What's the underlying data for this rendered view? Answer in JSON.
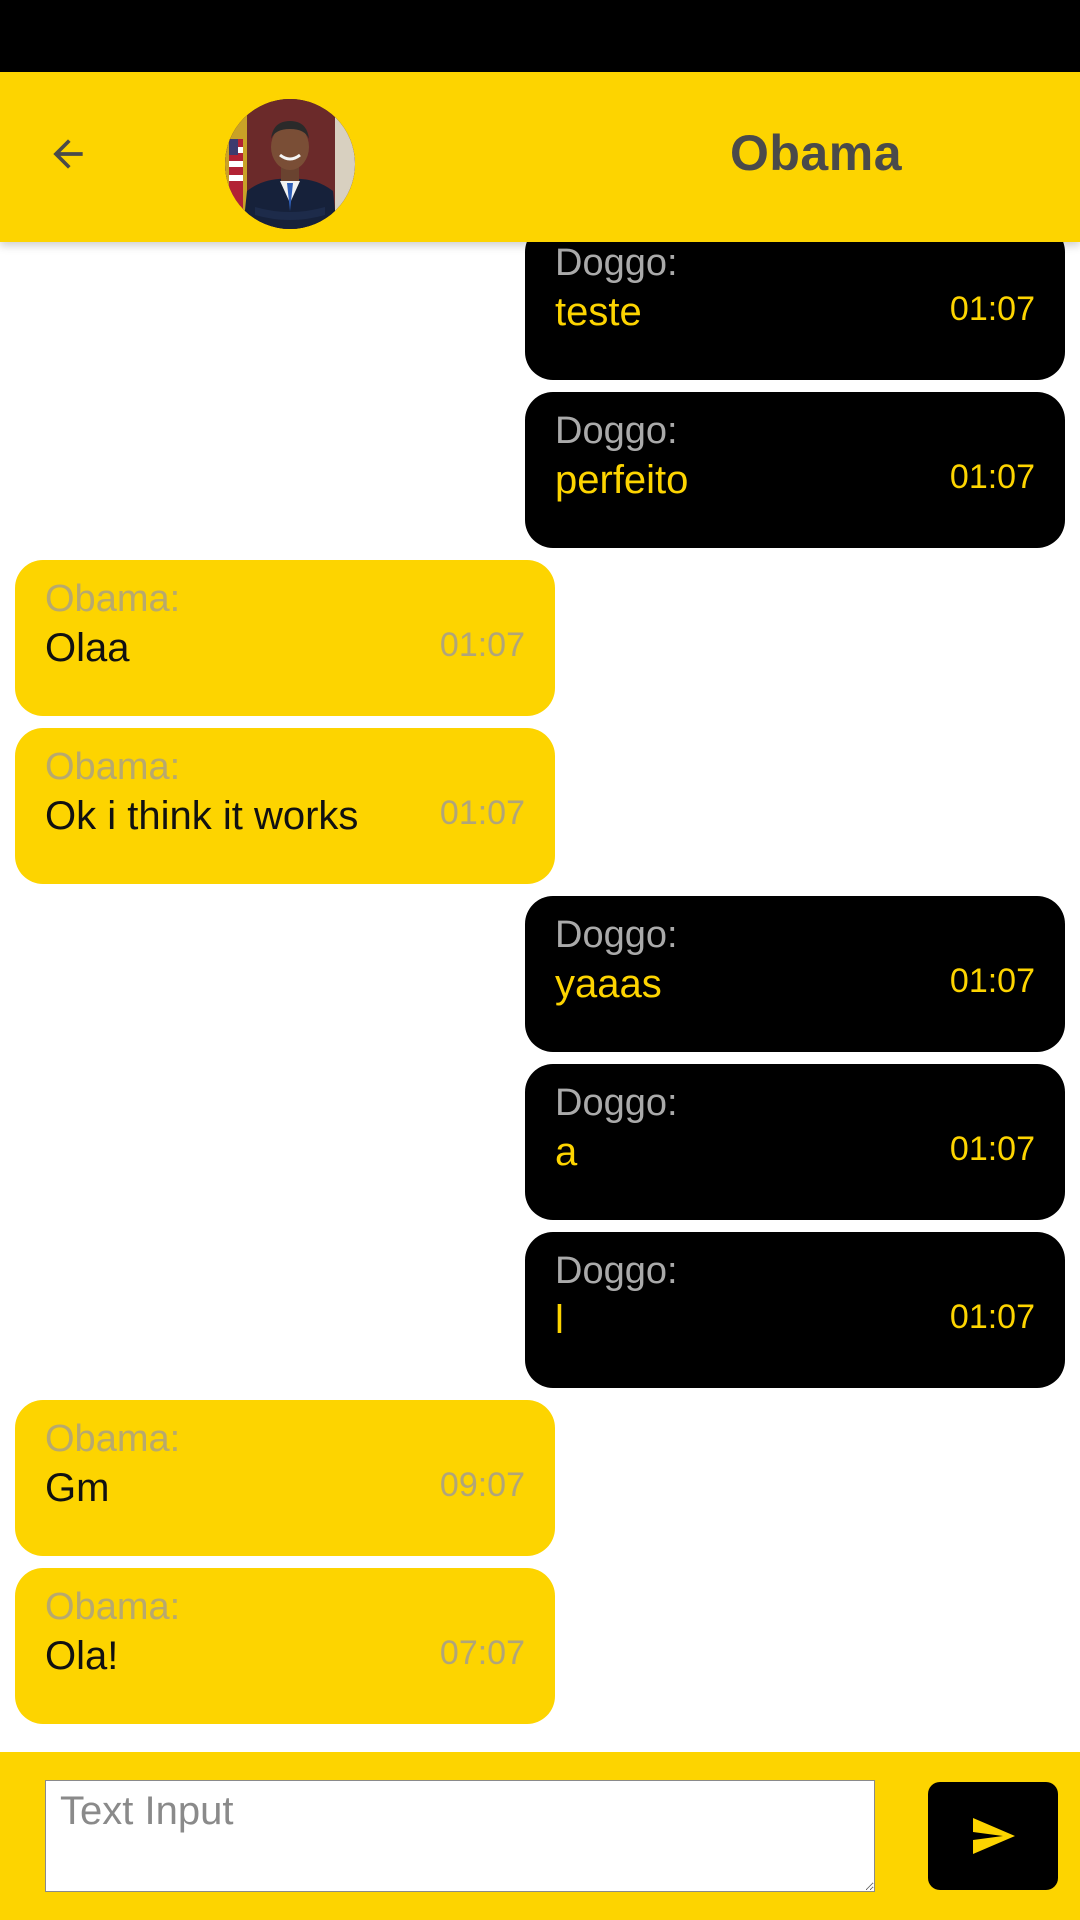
{
  "header": {
    "title": "Obama",
    "back_icon": "arrow-left-icon",
    "avatar_alt": "Obama avatar"
  },
  "colors": {
    "accent": "#FDD400",
    "sent_bubble": "#000000",
    "header_text": "#4A4A4A"
  },
  "messages": [
    {
      "side": "sent",
      "sender": "Doggo:",
      "text": "teste",
      "time": "01:07"
    },
    {
      "side": "sent",
      "sender": "Doggo:",
      "text": "perfeito",
      "time": "01:07"
    },
    {
      "side": "received",
      "sender": "Obama:",
      "text": "Olaa",
      "time": "01:07"
    },
    {
      "side": "received",
      "sender": "Obama:",
      "text": "Ok i think it works",
      "time": "01:07"
    },
    {
      "side": "sent",
      "sender": "Doggo:",
      "text": "yaaas",
      "time": "01:07"
    },
    {
      "side": "sent",
      "sender": "Doggo:",
      "text": "a",
      "time": "01:07"
    },
    {
      "side": "sent",
      "sender": "Doggo:",
      "text": "l",
      "time": "01:07"
    },
    {
      "side": "received",
      "sender": "Obama:",
      "text": "Gm",
      "time": "09:07"
    },
    {
      "side": "received",
      "sender": "Obama:",
      "text": "Ola!",
      "time": "07:07"
    }
  ],
  "composer": {
    "placeholder": "Text Input",
    "value": "",
    "send_icon": "send-icon"
  }
}
